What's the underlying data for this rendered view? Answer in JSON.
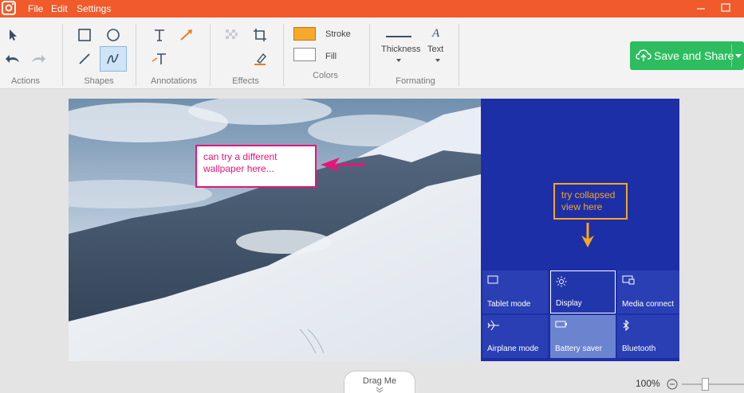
{
  "menu": {
    "file": "File",
    "edit": "Edit",
    "settings": "Settings"
  },
  "ribbon": {
    "groups": {
      "actions": "Actions",
      "shapes": "Shapes",
      "annotations": "Annotations",
      "effects": "Effects",
      "colors": "Colors",
      "formatting": "Formating"
    },
    "stroke_label": "Stroke",
    "fill_label": "Fill",
    "thickness_label": "Thickness",
    "text_label": "Text",
    "stroke_color": "#f7a92b",
    "fill_color": "#ffffff"
  },
  "save_button": {
    "label": "Save and Share",
    "color": "#2dbd5f"
  },
  "canvas": {
    "callout_wallpaper": [
      "can try a different",
      "wallpaper here..."
    ],
    "callout_collapsed": [
      "try collapsed",
      "view here"
    ],
    "wallpaper_callout_color": "#e6157a",
    "collapsed_callout_color": "#f5a623",
    "tiles": [
      {
        "label": "Tablet mode",
        "icon": "tablet-icon"
      },
      {
        "label": "Display",
        "icon": "brightness-icon"
      },
      {
        "label": "Media connect",
        "icon": "cast-icon"
      },
      {
        "label": "Airplane mode",
        "icon": "airplane-icon"
      },
      {
        "label": "Battery saver",
        "icon": "battery-icon"
      },
      {
        "label": "Bluetooth",
        "icon": "bluetooth-icon"
      }
    ]
  },
  "bottom": {
    "drag_label": "Drag Me",
    "zoom": "100%"
  }
}
